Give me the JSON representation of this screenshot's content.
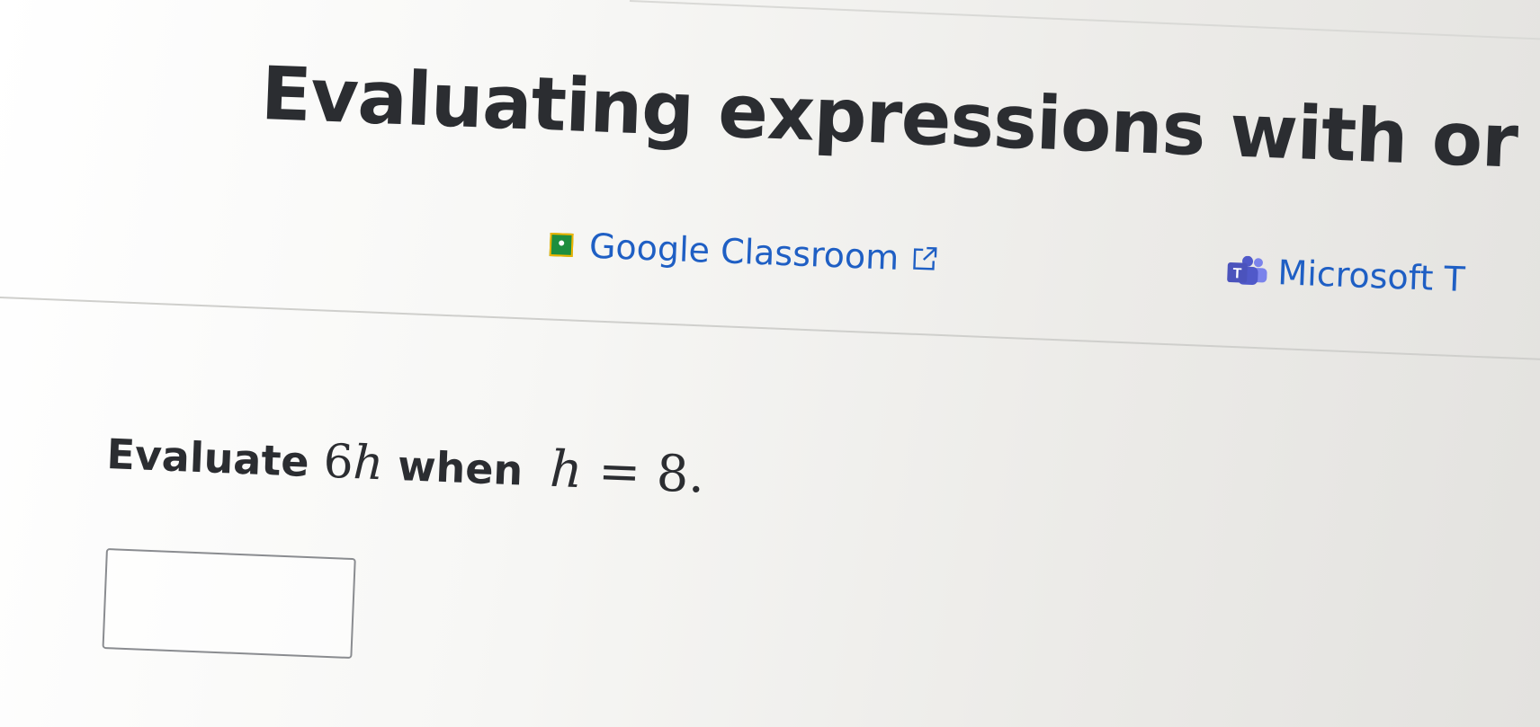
{
  "page": {
    "title": "Evaluating expressions with or",
    "share": {
      "google_classroom_label": "Google Classroom",
      "microsoft_label": "Microsoft T"
    },
    "question": {
      "prefix": "Evaluate",
      "expression_coef": "6",
      "expression_var": "h",
      "middle": "when",
      "condition_var": "h",
      "condition_rel": "= 8."
    },
    "answer": {
      "value": ""
    }
  },
  "colors": {
    "link": "#1f5fc4",
    "text": "#2b2d31",
    "google_classroom_green": "#1e8e3e",
    "teams_purple": "#4b53bc"
  },
  "icons": {
    "google_classroom": "google-classroom-icon",
    "external_link": "external-link-icon",
    "microsoft_teams": "microsoft-teams-icon"
  }
}
